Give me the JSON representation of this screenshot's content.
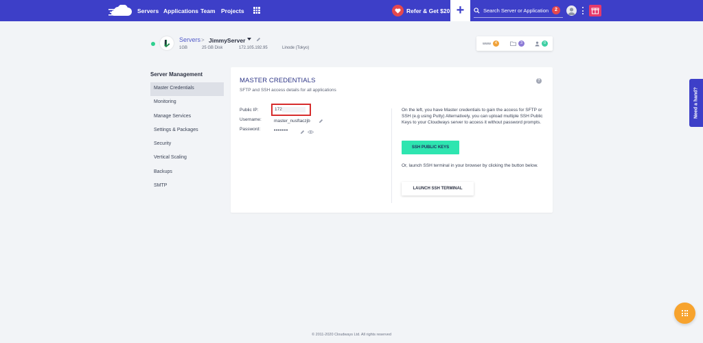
{
  "nav": {
    "links": [
      "Servers",
      "Applications",
      "Team",
      "Projects"
    ],
    "refer_label": "Refer & Get $20",
    "plus_label": "+",
    "search_placeholder": "Search Server or Application",
    "notification_count": "2"
  },
  "server": {
    "breadcrumb_root": "Servers",
    "breadcrumb_sep": ">",
    "name": "JimmyServer",
    "ram": "1GB",
    "disk": "25 GB Disk",
    "ip": "172.105.192.95",
    "location": "Linode (Tokyo)",
    "stats": [
      {
        "icon": "www",
        "count": "4",
        "color": "#f0a23a"
      },
      {
        "icon": "folder-icon",
        "count": "3",
        "color": "#8c7ad6"
      },
      {
        "icon": "user-icon",
        "count": "0",
        "color": "#3ecfa3"
      }
    ]
  },
  "sidebar": {
    "title": "Server Management",
    "items": [
      {
        "label": "Master Credentials",
        "active": true
      },
      {
        "label": "Monitoring"
      },
      {
        "label": "Manage Services"
      },
      {
        "label": "Settings & Packages"
      },
      {
        "label": "Security"
      },
      {
        "label": "Vertical Scaling"
      },
      {
        "label": "Backups"
      },
      {
        "label": "SMTP"
      }
    ]
  },
  "credentials": {
    "title": "MASTER CREDENTIALS",
    "subtitle": "SFTP and SSH access details for all applications",
    "help_icon": "?",
    "public_ip_label": "Public IP:",
    "public_ip_value": "172.",
    "username_label": "Username:",
    "username_value": "master_nusftaczjb",
    "password_label": "Password:",
    "password_value": "•••••••",
    "description": "On the left, you have Master credentials to gain the access for SFTP or SSH (e.g using Putty) Alternatively, you can upload multiple SSH Public Keys to your Cloudways server to access it without password prompts.",
    "ssh_keys_button": "SSH PUBLIC KEYS",
    "terminal_description": "Or, launch SSH terminal in your browser by clicking the button below.",
    "terminal_button": "LAUNCH SSH TERMINAL"
  },
  "need_hand": "Need a hand?",
  "footer": "© 2011-2020 Cloudways Ltd. All rights reserved",
  "colors": {
    "nav_bg": "#3d3fc8",
    "accent_green": "#2ee5b0",
    "highlight_red": "#d62b2b",
    "fab_orange": "#f7a32e"
  }
}
